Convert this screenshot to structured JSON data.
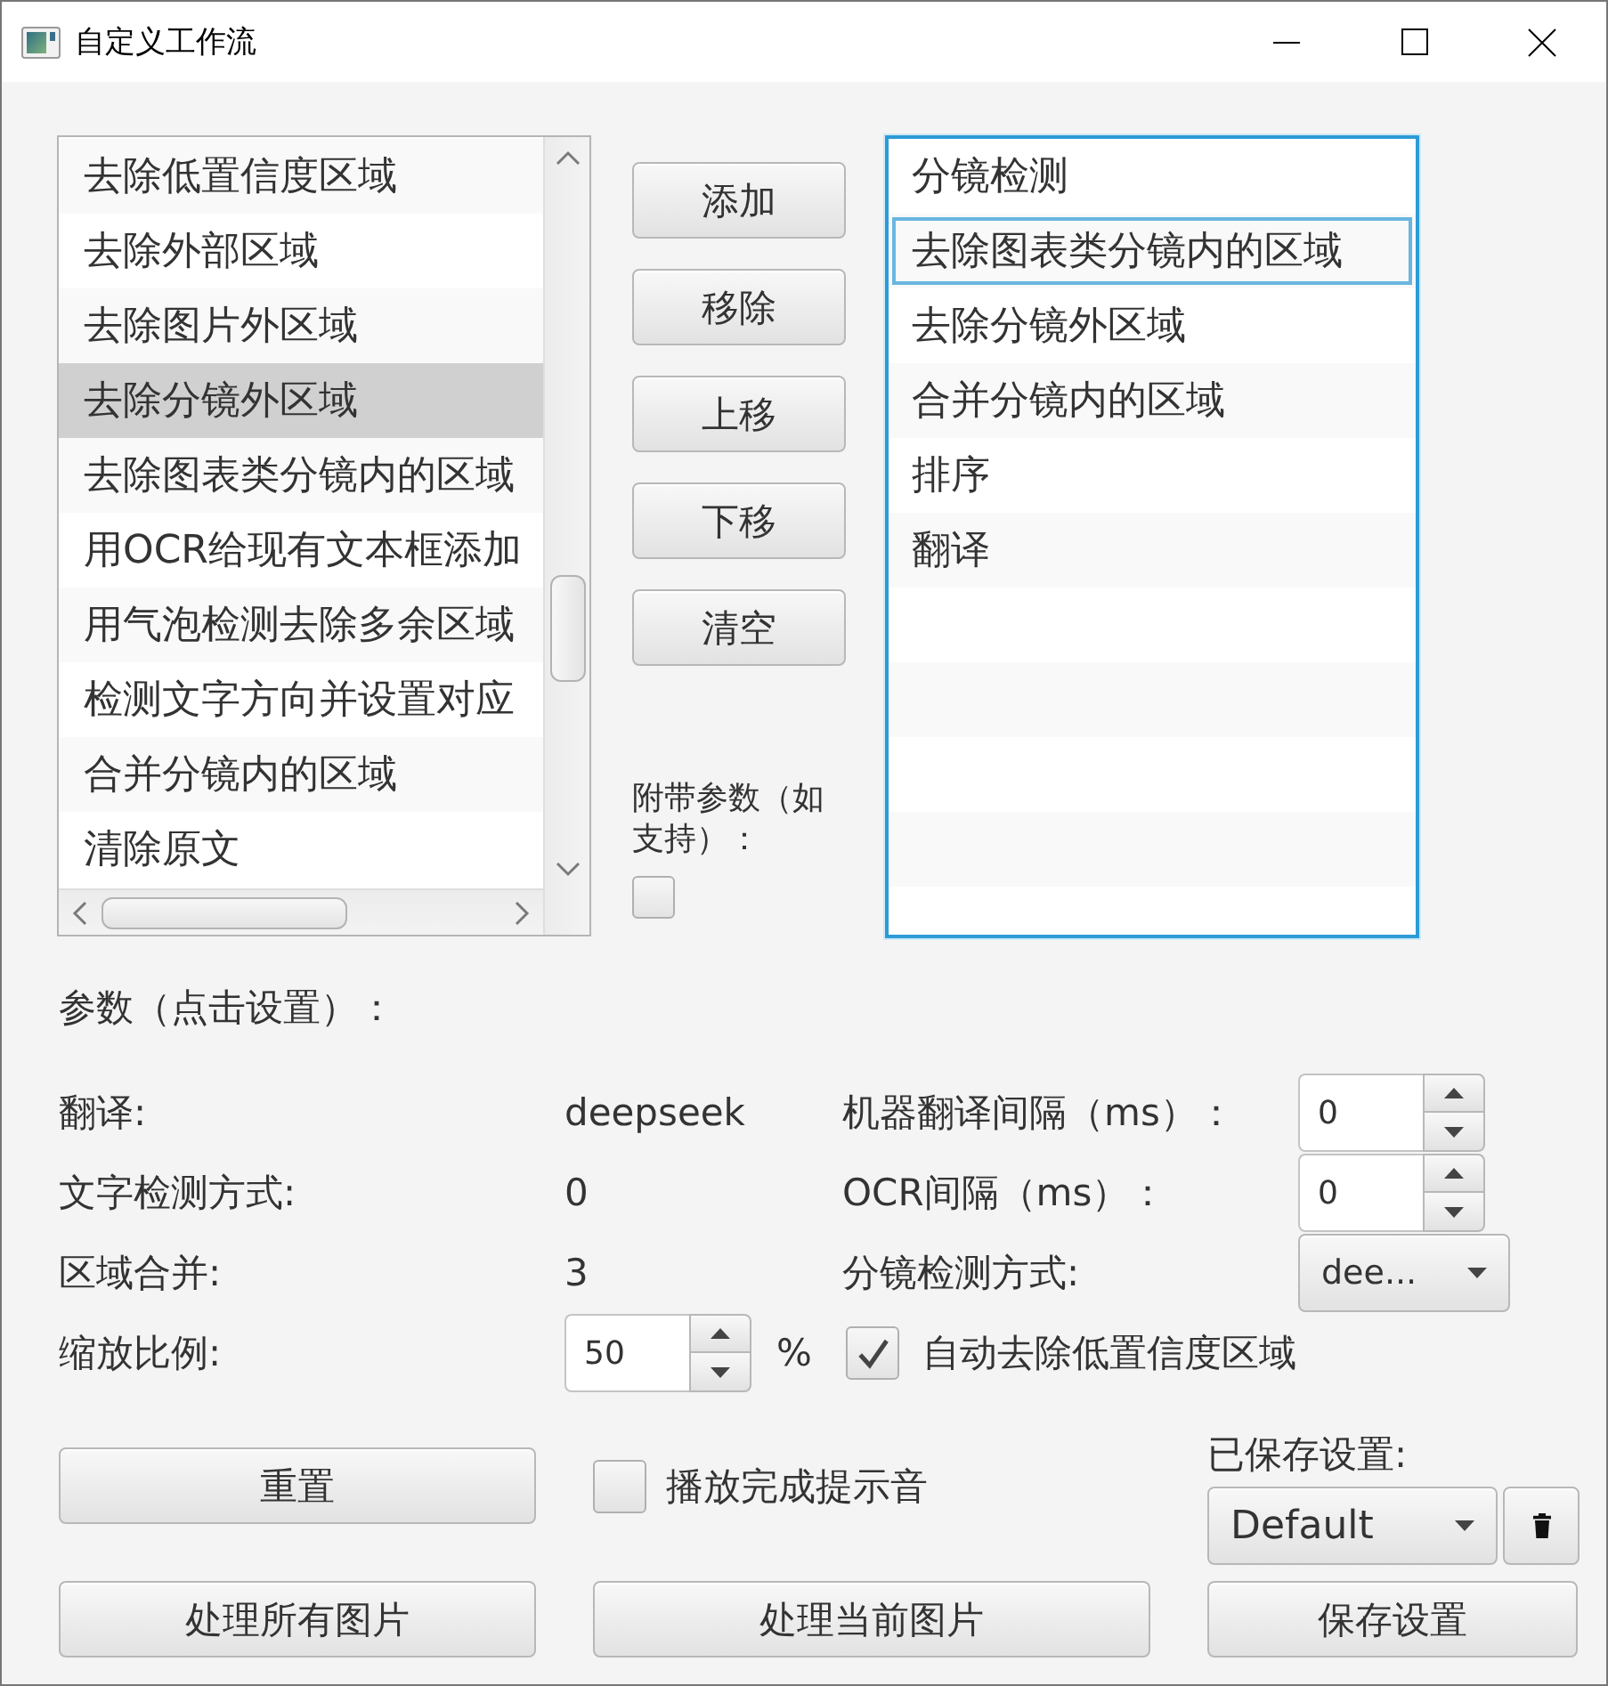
{
  "window": {
    "title": "自定义工作流"
  },
  "available_steps": [
    {
      "label": "去除低置信度区域",
      "selected": false
    },
    {
      "label": "去除外部区域",
      "selected": false
    },
    {
      "label": "去除图片外区域",
      "selected": false
    },
    {
      "label": "去除分镜外区域",
      "selected": true
    },
    {
      "label": "去除图表类分镜内的区域",
      "selected": false
    },
    {
      "label": "用OCR给现有文本框添加",
      "selected": false
    },
    {
      "label": "用气泡检测去除多余区域",
      "selected": false
    },
    {
      "label": "检测文字方向并设置对应",
      "selected": false
    },
    {
      "label": "合并分镜内的区域",
      "selected": false
    },
    {
      "label": "清除原文",
      "selected": false
    }
  ],
  "step_buttons": [
    "添加",
    "移除",
    "上移",
    "下移",
    "清空"
  ],
  "extra_params": {
    "label": "附带参数（如支持）：",
    "checked": false
  },
  "workflow_steps": [
    {
      "label": "分镜检测",
      "focused": false
    },
    {
      "label": "去除图表类分镜内的区域",
      "focused": true
    },
    {
      "label": "去除分镜外区域",
      "focused": false
    },
    {
      "label": "合并分镜内的区域",
      "focused": false
    },
    {
      "label": "排序",
      "focused": false
    },
    {
      "label": "翻译",
      "focused": false
    }
  ],
  "params": {
    "heading": "参数（点击设置）：",
    "rows": [
      {
        "left": {
          "kind": "value",
          "label": "翻译:",
          "value": "deepseek"
        },
        "right": {
          "kind": "spinner",
          "label": "机器翻译间隔（ms）：",
          "value": "0"
        }
      },
      {
        "left": {
          "kind": "value",
          "label": "文字检测方式:",
          "value": "0"
        },
        "right": {
          "kind": "spinner",
          "label": "OCR间隔（ms）：",
          "value": "0"
        }
      },
      {
        "left": {
          "kind": "value",
          "label": "区域合并:",
          "value": "3"
        },
        "right": {
          "kind": "combo",
          "label": "分镜检测方式:",
          "value": "dee..."
        }
      },
      {
        "left": {
          "kind": "spinner",
          "label": "缩放比例:",
          "value": "50",
          "unit": "%"
        },
        "right": {
          "kind": "checkbox",
          "label": "自动去除低置信度区域",
          "checked": true
        }
      }
    ]
  },
  "footer": {
    "reset": "重置",
    "sound": {
      "label": "播放完成提示音",
      "checked": false
    },
    "saved": {
      "label": "已保存设置:",
      "value": "Default"
    },
    "buttons": [
      "处理所有图片",
      "处理当前图片",
      "保存设置"
    ]
  }
}
